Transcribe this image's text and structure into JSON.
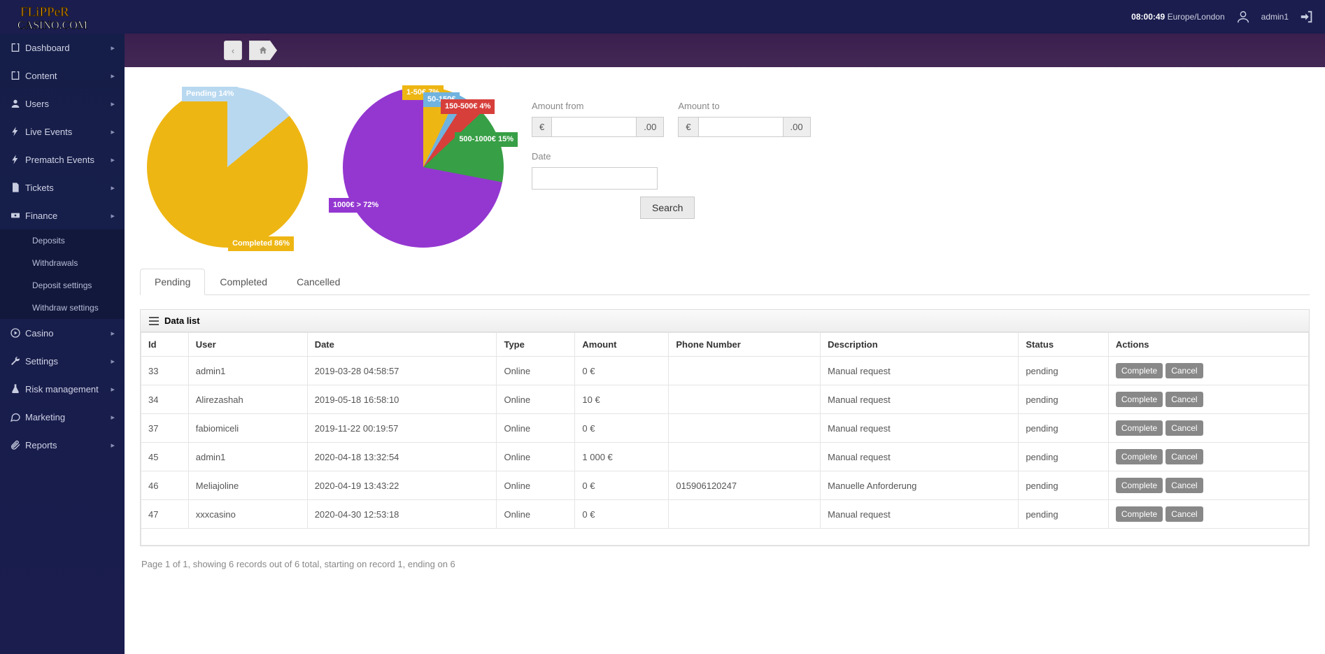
{
  "header": {
    "logo_top": "FLiPPeR",
    "logo_bottom": "CASINO.COM",
    "clock": "08:00:49",
    "timezone": "Europe/London",
    "username": "admin1"
  },
  "sidebar": {
    "items": [
      {
        "label": "Dashboard"
      },
      {
        "label": "Content"
      },
      {
        "label": "Users"
      },
      {
        "label": "Live Events"
      },
      {
        "label": "Prematch Events"
      },
      {
        "label": "Tickets"
      },
      {
        "label": "Finance"
      },
      {
        "label": "Casino"
      },
      {
        "label": "Settings"
      },
      {
        "label": "Risk management"
      },
      {
        "label": "Marketing"
      },
      {
        "label": "Reports"
      }
    ],
    "finance_sub": [
      {
        "label": "Deposits"
      },
      {
        "label": "Withdrawals"
      },
      {
        "label": "Deposit settings"
      },
      {
        "label": "Withdraw settings"
      }
    ]
  },
  "filters": {
    "amount_from_label": "Amount from",
    "amount_to_label": "Amount to",
    "date_label": "Date",
    "currency": "€",
    "decimal": ".00",
    "search_label": "Search"
  },
  "tabs": [
    "Pending",
    "Completed",
    "Cancelled"
  ],
  "panel_title": "Data list",
  "table": {
    "headers": [
      "Id",
      "User",
      "Date",
      "Type",
      "Amount",
      "Phone Number",
      "Description",
      "Status",
      "Actions"
    ],
    "rows": [
      {
        "id": "33",
        "user": "admin1",
        "date": "2019-03-28 04:58:57",
        "type": "Online",
        "amount": "0 €",
        "phone": "",
        "desc": "Manual request",
        "status": "pending"
      },
      {
        "id": "34",
        "user": "Alirezashah",
        "date": "2019-05-18 16:58:10",
        "type": "Online",
        "amount": "10 €",
        "phone": "",
        "desc": "Manual request",
        "status": "pending"
      },
      {
        "id": "37",
        "user": "fabiomiceli",
        "date": "2019-11-22 00:19:57",
        "type": "Online",
        "amount": "0 €",
        "phone": "",
        "desc": "Manual request",
        "status": "pending"
      },
      {
        "id": "45",
        "user": "admin1",
        "date": "2020-04-18 13:32:54",
        "type": "Online",
        "amount": "1 000 €",
        "phone": "",
        "desc": "Manual request",
        "status": "pending"
      },
      {
        "id": "46",
        "user": "Meliajoline",
        "date": "2020-04-19 13:43:22",
        "type": "Online",
        "amount": "0 €",
        "phone": "015906120247",
        "desc": "Manuelle Anforderung",
        "status": "pending"
      },
      {
        "id": "47",
        "user": "xxxcasino",
        "date": "2020-04-30 12:53:18",
        "type": "Online",
        "amount": "0 €",
        "phone": "",
        "desc": "Manual request",
        "status": "pending"
      }
    ],
    "complete_label": "Complete",
    "cancel_label": "Cancel"
  },
  "pager": "Page 1 of 1, showing 6 records out of 6 total, starting on record 1, ending on 6",
  "chart_data": [
    {
      "type": "pie",
      "title": "",
      "series": [
        {
          "name": "Pending",
          "value": 14,
          "label": "Pending\n14%",
          "color": "#b8d8f0"
        },
        {
          "name": "Completed",
          "value": 86,
          "label": "Completed\n86%",
          "color": "#eeb613"
        }
      ]
    },
    {
      "type": "pie",
      "title": "",
      "series": [
        {
          "name": "1-50€",
          "value": 7,
          "label": "1-50€\n7%",
          "color": "#eeb613"
        },
        {
          "name": "50-150€",
          "value": 2,
          "label": "50-150€",
          "color": "#70b3df"
        },
        {
          "name": "150-500€",
          "value": 4,
          "label": "150-500€\n4%",
          "color": "#d73f3b"
        },
        {
          "name": "500-1000€",
          "value": 15,
          "label": "500-1000€\n15%",
          "color": "#379f45"
        },
        {
          "name": "1000€ >",
          "value": 72,
          "label": "1000€ >\n72%",
          "color": "#9437d1"
        }
      ]
    }
  ]
}
